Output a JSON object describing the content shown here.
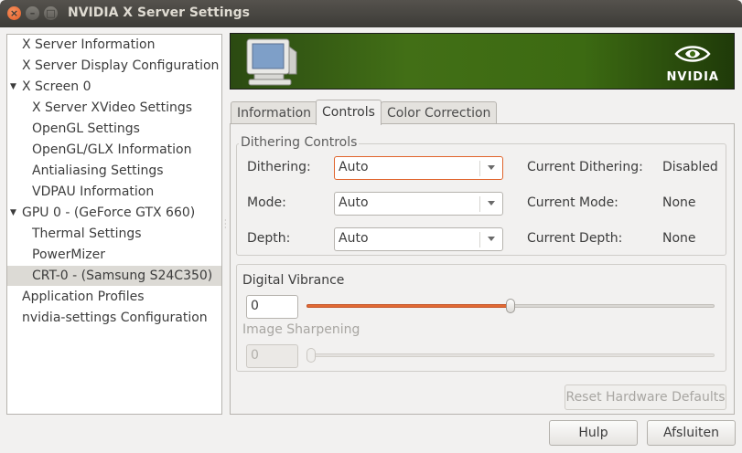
{
  "window": {
    "title": "NVIDIA X Server Settings"
  },
  "sidebar": {
    "items": [
      {
        "label": "X Server Information"
      },
      {
        "label": "X Server Display Configuration"
      },
      {
        "label": "X Screen 0"
      },
      {
        "label": "X Server XVideo Settings"
      },
      {
        "label": "OpenGL Settings"
      },
      {
        "label": "OpenGL/GLX Information"
      },
      {
        "label": "Antialiasing Settings"
      },
      {
        "label": "VDPAU Information"
      },
      {
        "label": "GPU 0 - (GeForce GTX 660)"
      },
      {
        "label": "Thermal Settings"
      },
      {
        "label": "PowerMizer"
      },
      {
        "label": "CRT-0 - (Samsung S24C350)"
      },
      {
        "label": "Application Profiles"
      },
      {
        "label": "nvidia-settings Configuration"
      }
    ],
    "selected": "CRT-0 - (Samsung S24C350)"
  },
  "banner": {
    "brand": "NVIDIA",
    "icon": "monitor-icon"
  },
  "tabs": [
    {
      "label": "Information"
    },
    {
      "label": "Controls"
    },
    {
      "label": "Color Correction"
    }
  ],
  "active_tab": "Controls",
  "dithering": {
    "frame_label": "Dithering Controls",
    "rows": [
      {
        "label": "Dithering:",
        "value": "Auto",
        "current_label": "Current Dithering:",
        "current_value": "Disabled"
      },
      {
        "label": "Mode:",
        "value": "Auto",
        "current_label": "Current Mode:",
        "current_value": "None"
      },
      {
        "label": "Depth:",
        "value": "Auto",
        "current_label": "Current Depth:",
        "current_value": "None"
      }
    ]
  },
  "vibrance": {
    "label": "Digital Vibrance",
    "value": "0",
    "slider_fraction": 0.5
  },
  "sharpening": {
    "label": "Image Sharpening",
    "value": "0",
    "slider_fraction": 0.0,
    "disabled": true
  },
  "buttons": {
    "reset": "Reset Hardware Defaults",
    "help": "Hulp",
    "quit": "Afsluiten"
  },
  "colors": {
    "accent": "#e26a33",
    "nvidia_green": "#76b900"
  }
}
